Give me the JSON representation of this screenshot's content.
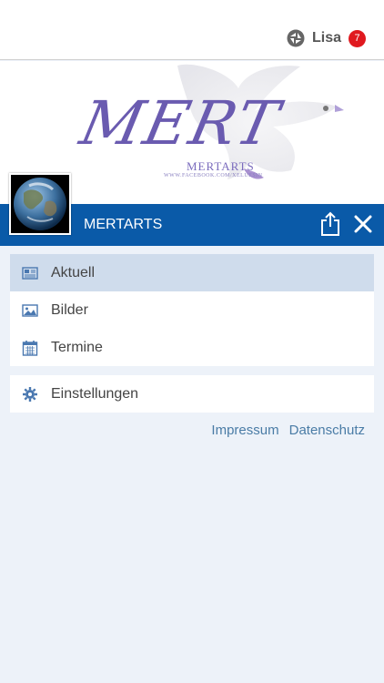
{
  "topbar": {
    "user_name": "Lisa",
    "badge_count": "7",
    "badge_color": "#e0191f"
  },
  "banner": {
    "logo_text": "MERT",
    "logo_sub": "MERTARTS",
    "logo_url": "WWW.FACEBOOK.COM/XELUESIN"
  },
  "header": {
    "title": "MERTARTS",
    "color": "#0a5aa8"
  },
  "menu": {
    "items": [
      {
        "label": "Aktuell",
        "icon": "newspaper-icon",
        "active": true
      },
      {
        "label": "Bilder",
        "icon": "image-icon",
        "active": false
      },
      {
        "label": "Termine",
        "icon": "calendar-icon",
        "active": false
      }
    ],
    "settings": {
      "label": "Einstellungen",
      "icon": "gear-icon"
    }
  },
  "footer": {
    "impressum": "Impressum",
    "datenschutz": "Datenschutz"
  }
}
